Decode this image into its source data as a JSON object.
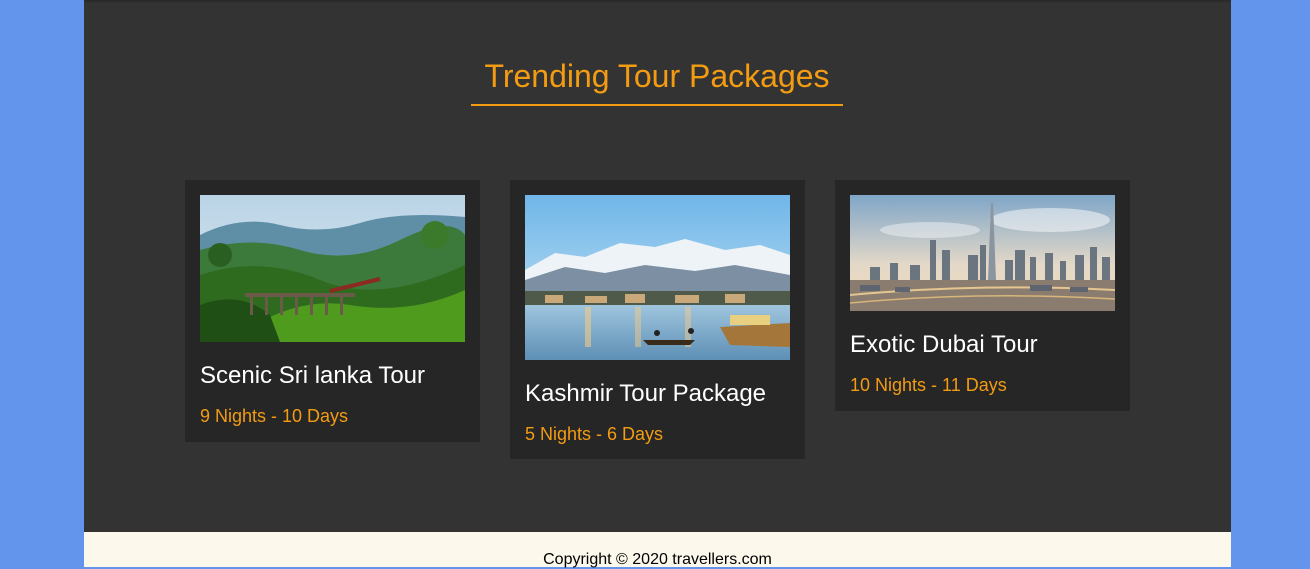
{
  "section": {
    "title": "Trending Tour Packages"
  },
  "packages": [
    {
      "name": "Scenic Sri lanka Tour",
      "duration": "9 Nights - 10 Days",
      "image": "sri-lanka-train-bridge-photo"
    },
    {
      "name": "Kashmir Tour Package",
      "duration": "5 Nights - 6 Days",
      "image": "kashmir-lake-mountains-photo"
    },
    {
      "name": "Exotic Dubai Tour",
      "duration": "10 Nights - 11 Days",
      "image": "dubai-skyline-photo"
    }
  ],
  "footer": {
    "copyright": "Copyright © 2020 travellers.com"
  },
  "colors": {
    "accent": "#f39c12",
    "section_bg": "#333333",
    "card_bg": "#262626",
    "page_bg": "#6495ed",
    "footer_bg": "#fdf8ec"
  }
}
